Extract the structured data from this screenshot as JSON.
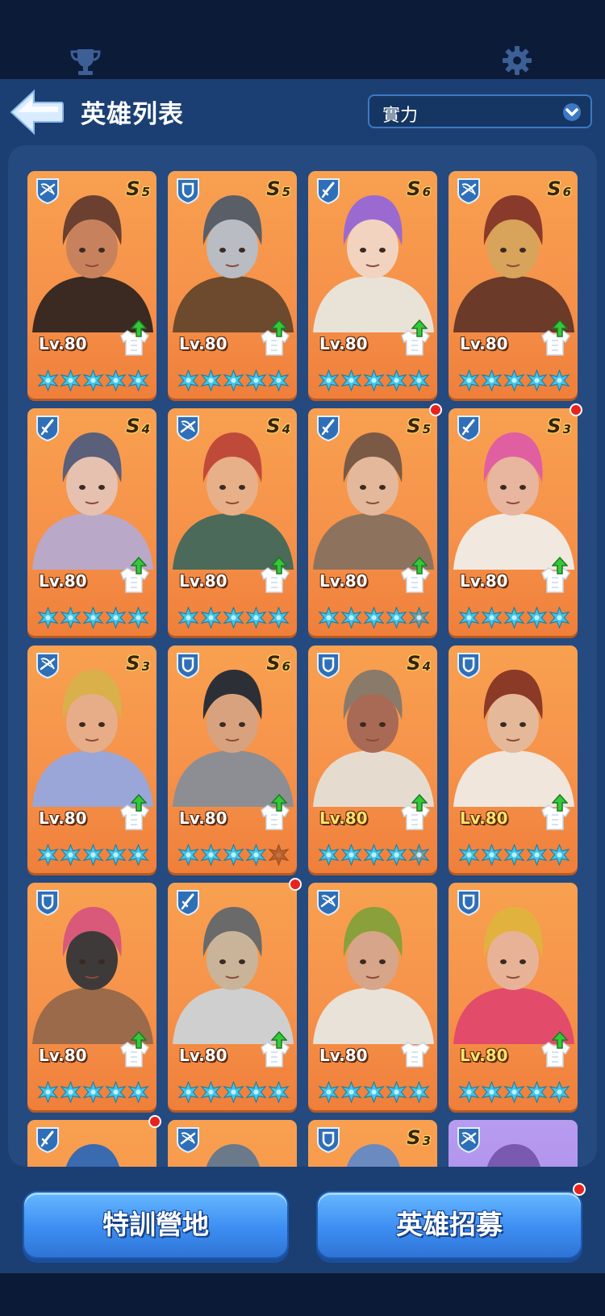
{
  "topbar": {
    "left_icon": "trophy-icon",
    "right_icon": "gear-icon"
  },
  "header": {
    "back_icon": "back-arrow-icon",
    "title": "英雄列表",
    "sort_value": "實力",
    "sort_icon": "chevron-down-icon"
  },
  "colors": {
    "card_orange": "#f6924a",
    "panel_blue": "#1b3f73",
    "star_teal": "#43c4e6",
    "star_empty": "#b7622e",
    "button_blue": "#3d8ef2",
    "red_dot": "#e8231d"
  },
  "heroes": [
    {
      "role": "ranged-icon",
      "rank": "S",
      "rank_num": "5",
      "level": "Lv.80",
      "gold_level": false,
      "stars": 5,
      "upgrade": true,
      "red_dot": false
    },
    {
      "role": "shield-icon",
      "rank": "S",
      "rank_num": "5",
      "level": "Lv.80",
      "gold_level": false,
      "stars": 5,
      "upgrade": true,
      "red_dot": false
    },
    {
      "role": "sword-icon",
      "rank": "S",
      "rank_num": "6",
      "level": "Lv.80",
      "gold_level": false,
      "stars": 5,
      "upgrade": true,
      "red_dot": false
    },
    {
      "role": "ranged-icon",
      "rank": "S",
      "rank_num": "6",
      "level": "Lv.80",
      "gold_level": false,
      "stars": 5,
      "upgrade": true,
      "red_dot": false
    },
    {
      "role": "sword-icon",
      "rank": "S",
      "rank_num": "4",
      "level": "Lv.80",
      "gold_level": false,
      "stars": 5,
      "upgrade": true,
      "red_dot": false
    },
    {
      "role": "ranged-icon",
      "rank": "S",
      "rank_num": "4",
      "level": "Lv.80",
      "gold_level": false,
      "stars": 5,
      "upgrade": true,
      "red_dot": false
    },
    {
      "role": "sword-icon",
      "rank": "S",
      "rank_num": "5",
      "level": "Lv.80",
      "gold_level": false,
      "stars": 4.5,
      "upgrade": true,
      "red_dot": true
    },
    {
      "role": "sword-icon",
      "rank": "S",
      "rank_num": "3",
      "level": "Lv.80",
      "gold_level": false,
      "stars": 5,
      "upgrade": true,
      "red_dot": true
    },
    {
      "role": "ranged-icon",
      "rank": "S",
      "rank_num": "3",
      "level": "Lv.80",
      "gold_level": false,
      "stars": 5,
      "upgrade": true,
      "red_dot": false
    },
    {
      "role": "shield-icon",
      "rank": "S",
      "rank_num": "6",
      "level": "Lv.80",
      "gold_level": false,
      "stars": 4,
      "upgrade": true,
      "red_dot": false
    },
    {
      "role": "shield-icon",
      "rank": "S",
      "rank_num": "4",
      "level": "Lv.80",
      "gold_level": true,
      "stars": 4.5,
      "upgrade": true,
      "red_dot": false
    },
    {
      "role": "shield-icon",
      "rank": "",
      "rank_num": "",
      "level": "Lv.80",
      "gold_level": true,
      "stars": 5,
      "upgrade": true,
      "red_dot": false
    },
    {
      "role": "shield-icon",
      "rank": "",
      "rank_num": "",
      "level": "Lv.80",
      "gold_level": false,
      "stars": 5,
      "upgrade": true,
      "red_dot": false
    },
    {
      "role": "sword-icon",
      "rank": "",
      "rank_num": "",
      "level": "Lv.80",
      "gold_level": false,
      "stars": 5,
      "upgrade": true,
      "red_dot": true
    },
    {
      "role": "ranged-icon",
      "rank": "",
      "rank_num": "",
      "level": "Lv.80",
      "gold_level": false,
      "stars": 5,
      "upgrade": false,
      "red_dot": false
    },
    {
      "role": "shield-icon",
      "rank": "",
      "rank_num": "",
      "level": "Lv.80",
      "gold_level": true,
      "stars": 5,
      "upgrade": true,
      "red_dot": false
    },
    {
      "role": "sword-icon",
      "rank": "",
      "rank_num": "",
      "level": "",
      "gold_level": false,
      "stars": 0,
      "upgrade": false,
      "red_dot": true
    },
    {
      "role": "ranged-icon",
      "rank": "",
      "rank_num": "",
      "level": "",
      "gold_level": false,
      "stars": 0,
      "upgrade": false,
      "red_dot": false
    },
    {
      "role": "shield-icon",
      "rank": "S",
      "rank_num": "3",
      "level": "",
      "gold_level": false,
      "stars": 0,
      "upgrade": false,
      "red_dot": false
    },
    {
      "role": "ranged-icon",
      "rank": "",
      "rank_num": "",
      "level": "",
      "gold_level": false,
      "stars": 0,
      "upgrade": false,
      "red_dot": false,
      "purple": true
    }
  ],
  "buttons": {
    "training": "特訓營地",
    "recruit": "英雄招募",
    "recruit_red_dot": true
  }
}
